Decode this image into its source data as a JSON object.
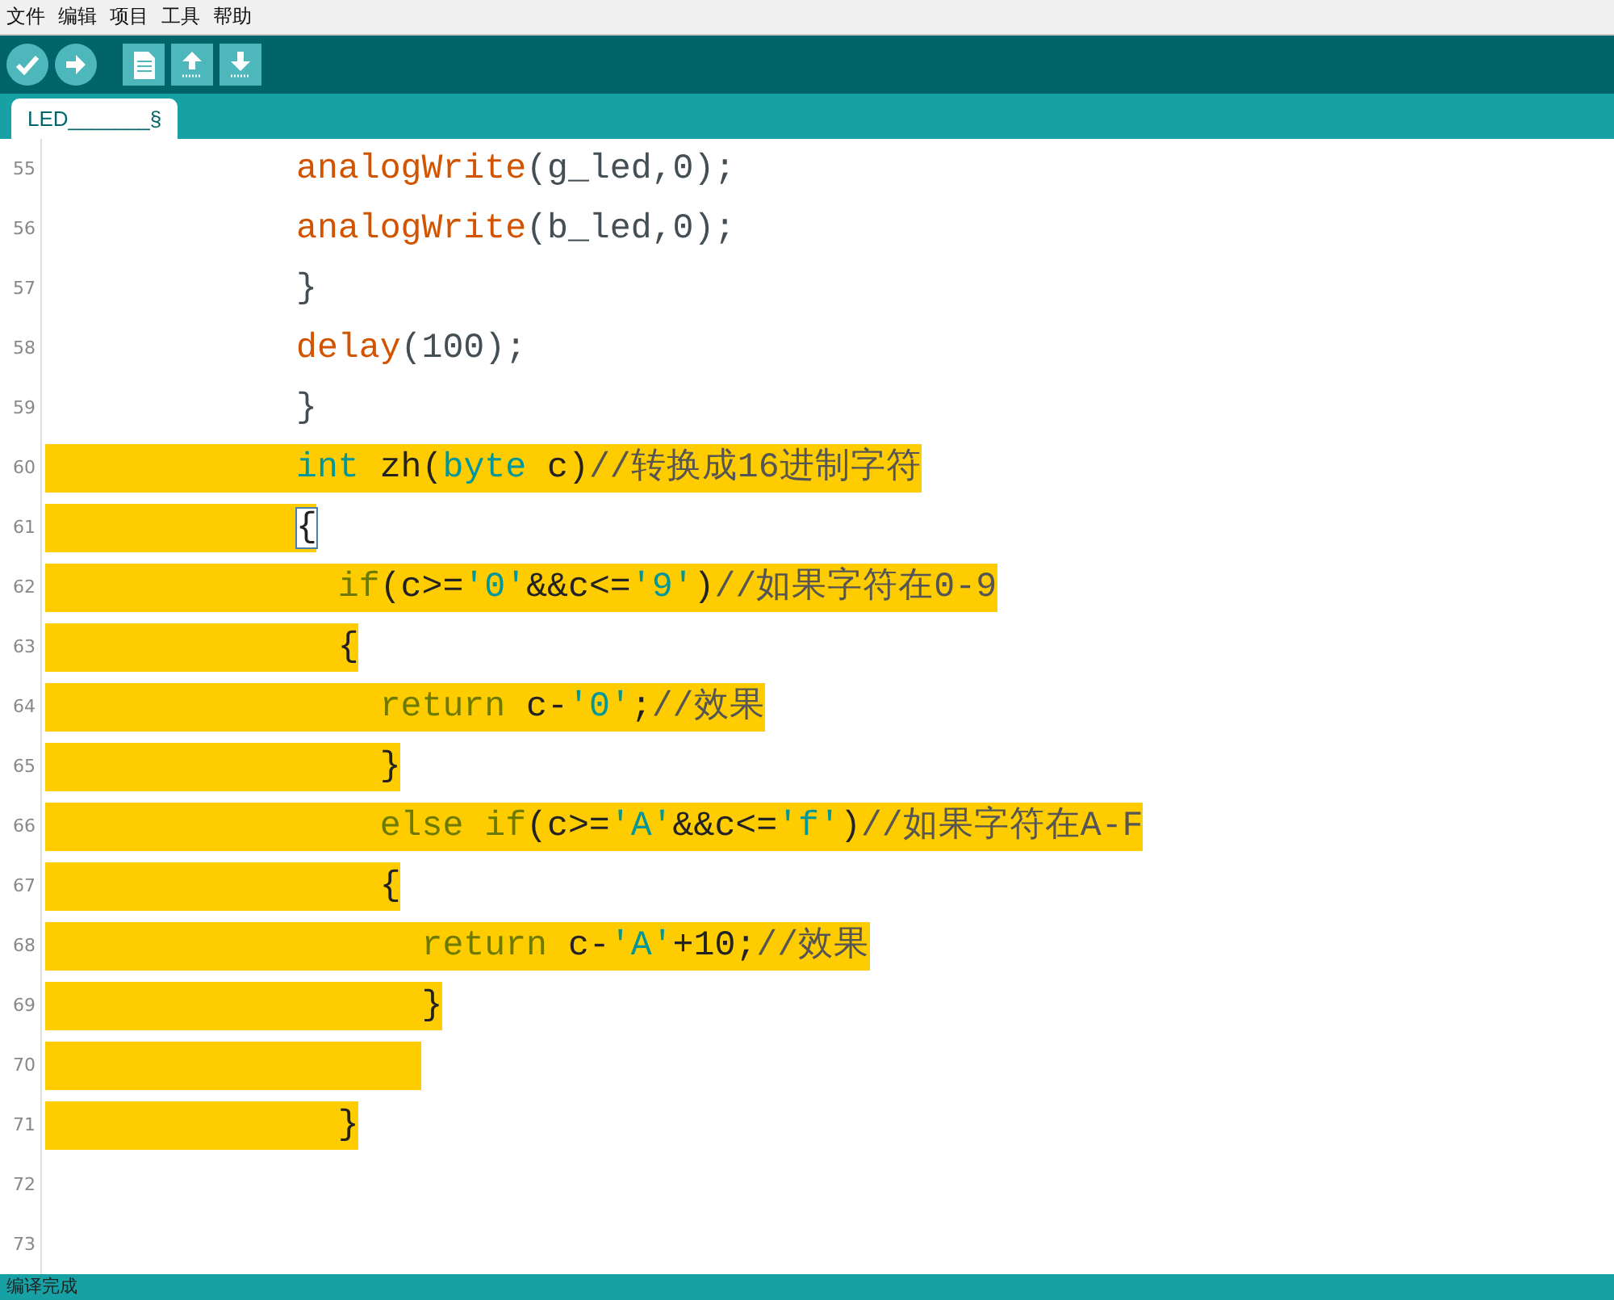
{
  "menu": [
    "文件",
    "编辑",
    "项目",
    "工具",
    "帮助"
  ],
  "toolbar": [
    {
      "kind": "verify"
    },
    {
      "kind": "upload"
    },
    {
      "kind": "new"
    },
    {
      "kind": "open"
    },
    {
      "kind": "save"
    }
  ],
  "tabs": [
    {
      "label": "LED_______§",
      "selected": true
    }
  ],
  "lines": [
    {
      "number": "55",
      "selected": false,
      "cursor": false,
      "tokens": [
        {
          "kind": "function",
          "text": "            analogWrite"
        },
        {
          "kind": "plain",
          "text": "(g_led,0);"
        }
      ]
    },
    {
      "number": "56",
      "selected": false,
      "cursor": false,
      "tokens": [
        {
          "kind": "function",
          "text": "            analogWrite"
        },
        {
          "kind": "plain",
          "text": "(b_led,0);"
        }
      ]
    },
    {
      "number": "57",
      "selected": false,
      "cursor": false,
      "tokens": [
        {
          "kind": "plain",
          "text": "            }"
        }
      ]
    },
    {
      "number": "58",
      "selected": false,
      "cursor": false,
      "tokens": [
        {
          "kind": "function",
          "text": "            delay"
        },
        {
          "kind": "plain",
          "text": "(100);"
        }
      ]
    },
    {
      "number": "59",
      "selected": false,
      "cursor": false,
      "tokens": [
        {
          "kind": "plain",
          "text": "            }"
        }
      ]
    },
    {
      "number": "60",
      "selected": true,
      "cursor": false,
      "tokens": [
        {
          "kind": "type",
          "text": "            int"
        },
        {
          "kind": "plain",
          "text": " zh("
        },
        {
          "kind": "type",
          "text": "byte"
        },
        {
          "kind": "plain",
          "text": " c)"
        },
        {
          "kind": "comment",
          "text": "//转换成16进制字符"
        }
      ]
    },
    {
      "number": "61",
      "selected": true,
      "cursor": true,
      "tokens": [
        {
          "kind": "plain",
          "text": "            {"
        }
      ]
    },
    {
      "number": "62",
      "selected": true,
      "cursor": false,
      "tokens": [
        {
          "kind": "control",
          "text": "              if"
        },
        {
          "kind": "plain",
          "text": "(c>="
        },
        {
          "kind": "type",
          "text": "'0'"
        },
        {
          "kind": "plain",
          "text": "&&c<="
        },
        {
          "kind": "type",
          "text": "'9'"
        },
        {
          "kind": "plain",
          "text": ")"
        },
        {
          "kind": "comment",
          "text": "//如果字符在0-9"
        }
      ]
    },
    {
      "number": "63",
      "selected": true,
      "cursor": false,
      "tokens": [
        {
          "kind": "plain",
          "text": "              {"
        }
      ]
    },
    {
      "number": "64",
      "selected": true,
      "cursor": false,
      "tokens": [
        {
          "kind": "control",
          "text": "                return"
        },
        {
          "kind": "plain",
          "text": " c-"
        },
        {
          "kind": "type",
          "text": "'0'"
        },
        {
          "kind": "plain",
          "text": ";"
        },
        {
          "kind": "comment",
          "text": "//效果"
        }
      ]
    },
    {
      "number": "65",
      "selected": true,
      "cursor": false,
      "tokens": [
        {
          "kind": "plain",
          "text": "                }"
        }
      ]
    },
    {
      "number": "66",
      "selected": true,
      "cursor": false,
      "tokens": [
        {
          "kind": "control",
          "text": "                else if"
        },
        {
          "kind": "plain",
          "text": "(c>="
        },
        {
          "kind": "type",
          "text": "'A'"
        },
        {
          "kind": "plain",
          "text": "&&c<="
        },
        {
          "kind": "type",
          "text": "'f'"
        },
        {
          "kind": "plain",
          "text": ")"
        },
        {
          "kind": "comment",
          "text": "//如果字符在A-F"
        }
      ]
    },
    {
      "number": "67",
      "selected": true,
      "cursor": false,
      "tokens": [
        {
          "kind": "plain",
          "text": "                {"
        }
      ]
    },
    {
      "number": "68",
      "selected": true,
      "cursor": false,
      "tokens": [
        {
          "kind": "control",
          "text": "                  return"
        },
        {
          "kind": "plain",
          "text": " c-"
        },
        {
          "kind": "type",
          "text": "'A'"
        },
        {
          "kind": "plain",
          "text": "+10;"
        },
        {
          "kind": "comment",
          "text": "//效果"
        }
      ]
    },
    {
      "number": "69",
      "selected": true,
      "cursor": false,
      "tokens": [
        {
          "kind": "plain",
          "text": "                  }"
        }
      ]
    },
    {
      "number": "70",
      "selected": true,
      "cursor": false
    },
    {
      "number": "71",
      "selected": true,
      "cursor": false,
      "tokens": [
        {
          "kind": "plain",
          "text": "              }"
        }
      ]
    },
    {
      "number": "72",
      "selected": false,
      "cursor": false
    },
    {
      "number": "73",
      "selected": false,
      "cursor": false
    }
  ],
  "status_bar": {
    "text": "编译完成"
  }
}
